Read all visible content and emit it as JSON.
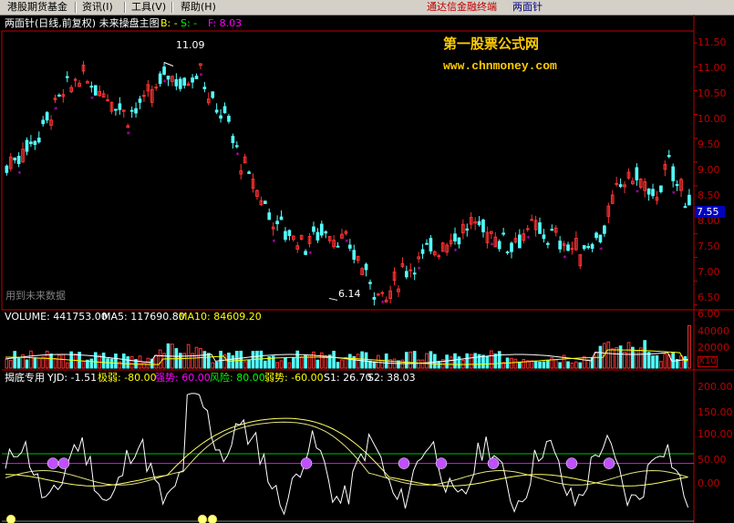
{
  "menu": {
    "items": [
      "港股期货基金",
      "资讯(I)",
      "工具(V)",
      "帮助(H)"
    ],
    "brand_text": "通达信金融终端",
    "brand_sub": "两面针"
  },
  "main_panel": {
    "title": "两面针(日线,前复权) 未来操盘主图",
    "b_label": "B: -",
    "s_label": "S: -",
    "f_label": "F: 8.03",
    "watermark_title": "第一股票公式网",
    "watermark_url": "www.chnmoney.com",
    "future_note": "用到未来数据",
    "high_label": "11.09",
    "low_label": "6.14",
    "price_tag": "7.55",
    "y_ticks": [
      "11.50",
      "11.00",
      "10.50",
      "10.00",
      "9.50",
      "9.00",
      "8.50",
      "8.00",
      "7.50",
      "7.00",
      "6.50",
      "6.00"
    ]
  },
  "volume_panel": {
    "volume_text": "VOLUME: 441753.00",
    "ma5_text": "MA5: 117690.80",
    "ma10_text": "MA10: 84609.20",
    "y_ticks": [
      "40000",
      "20000"
    ],
    "unit": "X10"
  },
  "indicator_panel": {
    "name": "揭底专用",
    "yjd": "YJD: -1.51",
    "jiruo": "极弱: -80.00",
    "qiangshi": "强势: 60.00",
    "fengxian": "风险: 80.00",
    "ruoshi": "弱势: -60.00",
    "s1": "S1: 26.70",
    "s2": "S2: 38.03",
    "y_ticks": [
      "200.00",
      "150.00",
      "100.00",
      "50.00",
      "0.00"
    ]
  },
  "colors": {
    "up": "#ff3232",
    "down": "#54fcfc",
    "axis": "#c00000",
    "grid": "#600000",
    "yellow": "#ffff00",
    "magenta": "#ff00ff",
    "green": "#00c000",
    "white": "#ffffff",
    "purple": "#c050ff",
    "price_tag_bg": "#0000c0"
  },
  "chart_data": {
    "type": "candlestick",
    "x_count": 170,
    "ylim": [
      5.9,
      11.75
    ],
    "price_path": [
      [
        0,
        8.9
      ],
      [
        8,
        9.6
      ],
      [
        12,
        10.2
      ],
      [
        18,
        10.8
      ],
      [
        24,
        10.5
      ],
      [
        30,
        10.0
      ],
      [
        36,
        10.4
      ],
      [
        40,
        10.9
      ],
      [
        44,
        10.6
      ],
      [
        48,
        11.09
      ],
      [
        50,
        10.3
      ],
      [
        54,
        10.0
      ],
      [
        58,
        9.0
      ],
      [
        62,
        8.4
      ],
      [
        66,
        7.8
      ],
      [
        70,
        7.5
      ],
      [
        74,
        7.3
      ],
      [
        78,
        7.6
      ],
      [
        82,
        7.4
      ],
      [
        86,
        7.1
      ],
      [
        90,
        6.5
      ],
      [
        94,
        6.14
      ],
      [
        98,
        6.7
      ],
      [
        104,
        7.1
      ],
      [
        110,
        7.4
      ],
      [
        116,
        7.7
      ],
      [
        124,
        7.3
      ],
      [
        130,
        7.6
      ],
      [
        136,
        7.4
      ],
      [
        142,
        7.1
      ],
      [
        148,
        7.6
      ],
      [
        152,
        8.6
      ],
      [
        156,
        8.7
      ],
      [
        160,
        8.2
      ],
      [
        164,
        8.9
      ],
      [
        168,
        8.3
      ],
      [
        172,
        8.3
      ],
      [
        176,
        8.0
      ],
      [
        178,
        8.1
      ],
      [
        180,
        8.2
      ]
    ],
    "volume_ylim": [
      0,
      50000
    ],
    "indicator_ylim": [
      -60,
      220
    ],
    "reference_lines": [
      {
        "name": "风险",
        "value": 80,
        "color": "#00c000"
      },
      {
        "name": "强势",
        "value": 60,
        "color": "#ff00ff"
      }
    ]
  }
}
